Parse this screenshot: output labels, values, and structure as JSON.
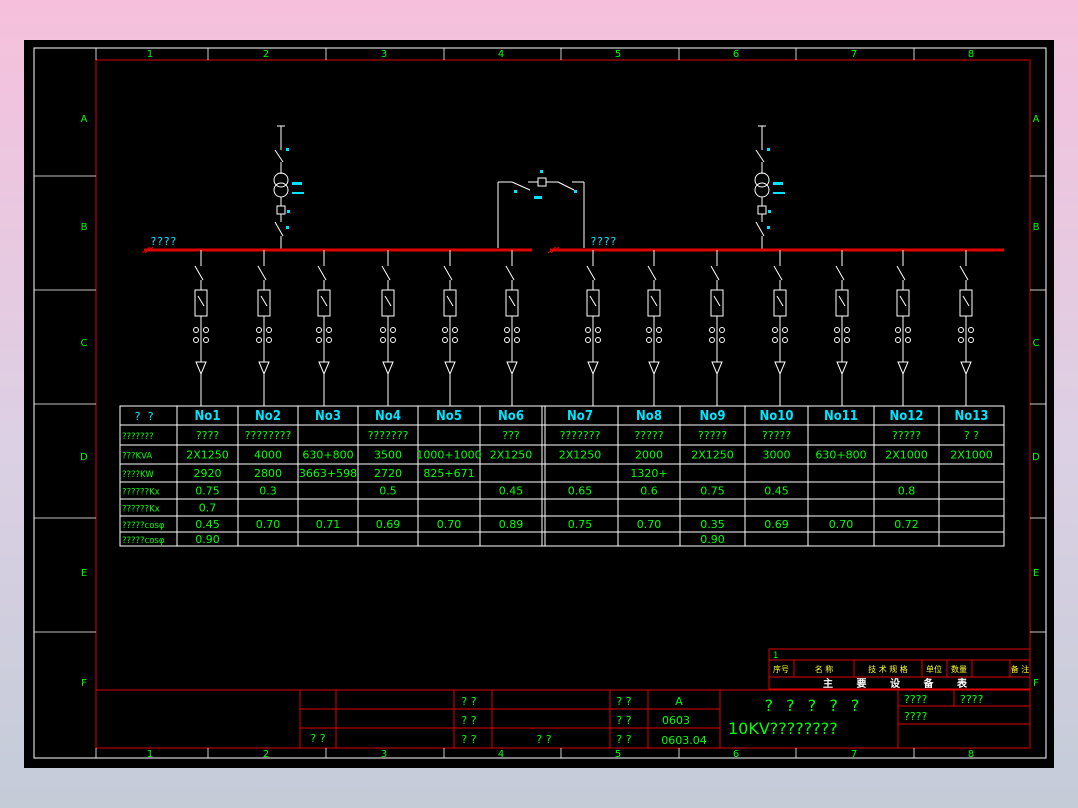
{
  "bus": {
    "left_label": "????",
    "right_label": "????"
  },
  "zones": {
    "columns": [
      "1",
      "2",
      "3",
      "4",
      "5",
      "6",
      "7",
      "8"
    ],
    "rows": [
      "A",
      "B",
      "C",
      "D",
      "E",
      "F"
    ]
  },
  "schedule": {
    "header_label": "? ?",
    "panels": [
      "No1",
      "No2",
      "No3",
      "No4",
      "No5",
      "No6",
      "No7",
      "No8",
      "No9",
      "No10",
      "No11",
      "No12",
      "No13"
    ],
    "rows": [
      {
        "label": "???????",
        "cells": [
          "????",
          "????????",
          "",
          "???????",
          "",
          "???",
          "???????",
          "?????",
          "?????",
          "?????",
          "",
          "?????",
          "? ?"
        ]
      },
      {
        "label": "???KVA",
        "cells": [
          "2X1250",
          "4000",
          "630+800",
          "3500",
          "1000+1000",
          "2X1250",
          "2X1250",
          "2000",
          "2X1250",
          "3000",
          "630+800",
          "2X1000",
          "2X1000"
        ]
      },
      {
        "label": "????KW",
        "cells": [
          "2920",
          "2800",
          "3663+598",
          "2720",
          "825+671",
          "",
          "",
          "1320+",
          "",
          "",
          "",
          "",
          ""
        ]
      },
      {
        "label": "??????Kx",
        "cells": [
          "0.75",
          "0.3",
          "",
          "0.5",
          "",
          "0.45",
          "0.65",
          "0.6",
          "0.75",
          "0.45",
          "",
          "0.8",
          ""
        ]
      },
      {
        "label": "??????Kx",
        "cells": [
          "0.7",
          "",
          "",
          "",
          "",
          "",
          "",
          "",
          "",
          "",
          "",
          "",
          ""
        ]
      },
      {
        "label": "?????cosφ",
        "cells": [
          "0.45",
          "0.70",
          "0.71",
          "0.69",
          "0.70",
          "0.89",
          "0.75",
          "0.70",
          "0.35",
          "0.69",
          "0.70",
          "0.72",
          ""
        ]
      },
      {
        "label": "?????cosφ",
        "cells": [
          "0.90",
          "",
          "",
          "",
          "",
          "",
          "",
          "",
          "0.90",
          "",
          "",
          "",
          ""
        ]
      }
    ]
  },
  "equipment_table": {
    "index": "1",
    "headers": [
      "序号",
      "名 称",
      "技 术 规 格",
      "单位",
      "数量",
      "备 注"
    ],
    "title": "主 要 设 备 表"
  },
  "title_block": {
    "design_label": "? ?",
    "row_labels": [
      "? ?",
      "? ?",
      "? ?"
    ],
    "approve_label": "? ?",
    "sheet_labels": [
      "? ?",
      "? ?",
      "? ?"
    ],
    "stage_value": "A",
    "drawing_no": "0603",
    "date_value": "0603.04",
    "project_name": "? ? ? ? ?",
    "drawing_title": "10KV????????",
    "right_labels": [
      "????",
      "????",
      "????"
    ]
  }
}
